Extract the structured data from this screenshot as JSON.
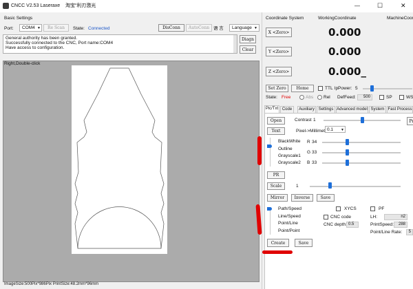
{
  "window": {
    "title": "CNCC V2.53 Laseraxe",
    "subtitle": "淘宝“利刃激光",
    "min_glyph": "—",
    "max_glyph": "☐",
    "close_glyph": "✕"
  },
  "basic_settings": {
    "title": "Basic Settings",
    "port_label": "Port:",
    "port_value": "COM4",
    "rescan_label": "Re Scan",
    "state_label": "State:",
    "state_value": "Connected",
    "disconn_label": "DisConn",
    "autoconn_label": "AutoConn",
    "lang_glyph": "语 言",
    "language_label": "Language",
    "log_lines": [
      "General authority has been granted.",
      "Successfully connected to the CNC, Port name:COM4",
      "Have access to configuration."
    ],
    "diagn_label": "Diagn",
    "clear_label": "Clear"
  },
  "canvas": {
    "hint": "Right,Double-click",
    "status": "ImageSize:500Pix*986Pix  PrintSize:48.2mm*96mm"
  },
  "coordinates": {
    "system_label": "Coordinate System",
    "working_label": "WorkingCoordinate",
    "machine_label": "MachineCoord",
    "x_btn": "X <Zero>",
    "y_btn": "Y <Zero>",
    "z_btn": "Z <Zero>",
    "x_val": "0.000",
    "y_val": "0.000",
    "z_val": "0.000_"
  },
  "controls": {
    "set_zero": "Set Zero",
    "home": "Home",
    "ttl_label": "TTL",
    "lp_power_label": "lpPower:",
    "lp_power_value": "5",
    "state_label": "State:",
    "state_value": "Free",
    "abs_label": "Abs",
    "rel_label": "Rel",
    "deffeed_label": "DefFeed:",
    "deffeed_value": "500",
    "sp_label": "SP",
    "ws_label": "WS"
  },
  "tabs": [
    "Pic/Txt",
    "Code",
    "Auxiliary",
    "Settings",
    "Advanced model",
    "System",
    "Fast Process"
  ],
  "pictxt": {
    "open_btn": "Open",
    "text_btn": "Text",
    "pr_btn": "PR",
    "pr_right": "Pr",
    "contrast_label": "Contrast",
    "contrast_value": "1",
    "pixmm_label": "Pixel->Millimeter",
    "pixmm_value": "0.1",
    "modes": [
      "BlackWhite",
      "Outline",
      "Grayscale1",
      "Grayscale2"
    ],
    "r_label": "R",
    "r_value": "34",
    "g_label": "G",
    "g_value": "33",
    "b_label": "B",
    "b_value": "33",
    "scale_btn": "Scale",
    "scale_value": "1",
    "mirror_btn": "Mirror",
    "inverse_btn": "Inverse",
    "save_btn": "Save",
    "path_modes": [
      "Path/Speed",
      "Line/Speed",
      "Point/Line",
      "Point/Point"
    ],
    "xycs_label": "XYCS",
    "pf_label": "PF",
    "cnc_code_label": "CNC code",
    "lh_label": "LH:",
    "lh_value": "n2",
    "cnc_depth_label": "CNC depth:",
    "cnc_depth_value": "0.5",
    "print_speed_label": "PrintSpeed:",
    "print_speed_value": "288",
    "pl_rate_label": "Point/Line Rate:",
    "pl_rate_value": "5",
    "create_btn": "Create",
    "save2_btn": "Save"
  },
  "colors": {
    "accent": "#1e6fd9",
    "connected": "#1a56c8",
    "state_free": "#e00000",
    "annotation": "#e00000"
  }
}
